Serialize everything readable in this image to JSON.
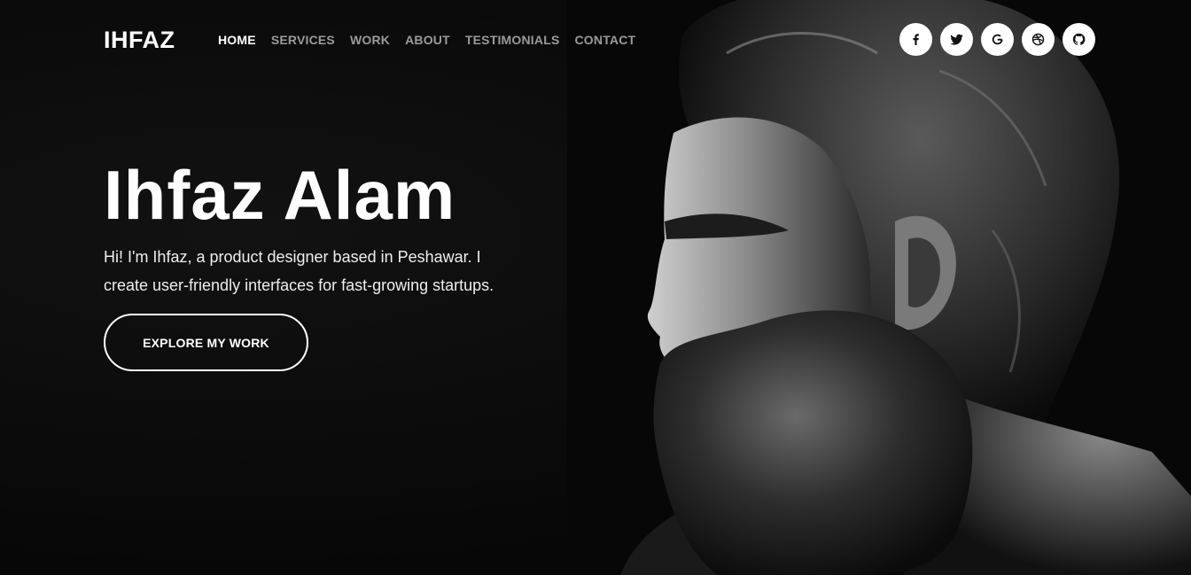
{
  "brand": {
    "logo": "IHFAZ"
  },
  "nav": {
    "items": [
      {
        "label": "HOME",
        "active": true
      },
      {
        "label": "SERVICES",
        "active": false
      },
      {
        "label": "WORK",
        "active": false
      },
      {
        "label": "ABOUT",
        "active": false
      },
      {
        "label": "TESTIMONIALS",
        "active": false
      },
      {
        "label": "CONTACT",
        "active": false
      }
    ]
  },
  "social": {
    "icons": [
      "facebook-icon",
      "twitter-icon",
      "google-icon",
      "dribbble-icon",
      "github-icon"
    ]
  },
  "hero": {
    "name": "Ihfaz Alam",
    "intro": "Hi! I'm Ihfaz, a product designer based in Peshawar. I create user-friendly interfaces for fast-growing startups.",
    "cta_label": "EXPLORE MY WORK"
  },
  "colors": {
    "background": "#080808",
    "text": "#ffffff",
    "nav_inactive": "#9a9a9a",
    "social_bg": "#ffffff"
  }
}
